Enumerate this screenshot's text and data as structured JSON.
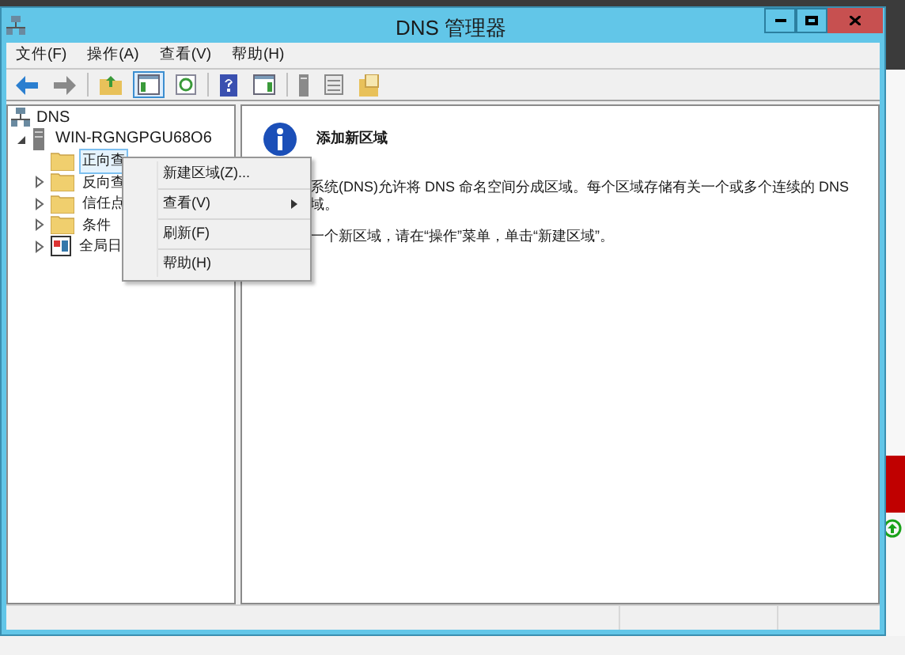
{
  "window": {
    "title": "DNS 管理器"
  },
  "menu_bar": [
    "文件(F)",
    "操作(A)",
    "查看(V)",
    "帮助(H)"
  ],
  "toolbar": [
    {
      "kind": "back",
      "selected": false
    },
    {
      "kind": "forward",
      "selected": false
    },
    {
      "kind": "up",
      "selected": false
    },
    {
      "kind": "tree",
      "selected": true
    },
    {
      "kind": "refresh",
      "selected": false
    },
    {
      "kind": "help",
      "selected": false
    },
    {
      "kind": "panel",
      "selected": false
    },
    {
      "kind": "server",
      "selected": false
    },
    {
      "kind": "list",
      "selected": false
    },
    {
      "kind": "folders",
      "selected": false
    }
  ],
  "tree": [
    {
      "label": "DNS",
      "kind": "root",
      "children": [
        {
          "label": "WIN-RGNGPGU68O6",
          "kind": "server",
          "expanded": true,
          "children": [
            {
              "label": "正向查",
              "kind": "folder",
              "has_children": false,
              "selected": true
            },
            {
              "label": "反向查",
              "kind": "folder",
              "has_children": true,
              "selected": false
            },
            {
              "label": "信任点",
              "kind": "folder",
              "has_children": true,
              "selected": false
            },
            {
              "label": "条件",
              "kind": "folder",
              "has_children": true,
              "selected": false
            },
            {
              "label": "全局日",
              "kind": "log",
              "has_children": true,
              "selected": false
            }
          ]
        }
      ]
    }
  ],
  "details": {
    "heading": "添加新区域",
    "paragraphs": [
      "系统(DNS)允许将 DNS 命名空间分成区域。每个区域存储有关一个或多个连续的 DNS",
      "域。",
      "一个新区域，请在“操作”菜单，单击“新建区域”。"
    ]
  },
  "context_menu": [
    {
      "label": "新建区域(Z)...",
      "submenu": false
    },
    {
      "label": "查看(V)",
      "submenu": true
    },
    {
      "label": "刷新(F)",
      "submenu": false
    },
    {
      "label": "帮助(H)",
      "submenu": false
    }
  ]
}
